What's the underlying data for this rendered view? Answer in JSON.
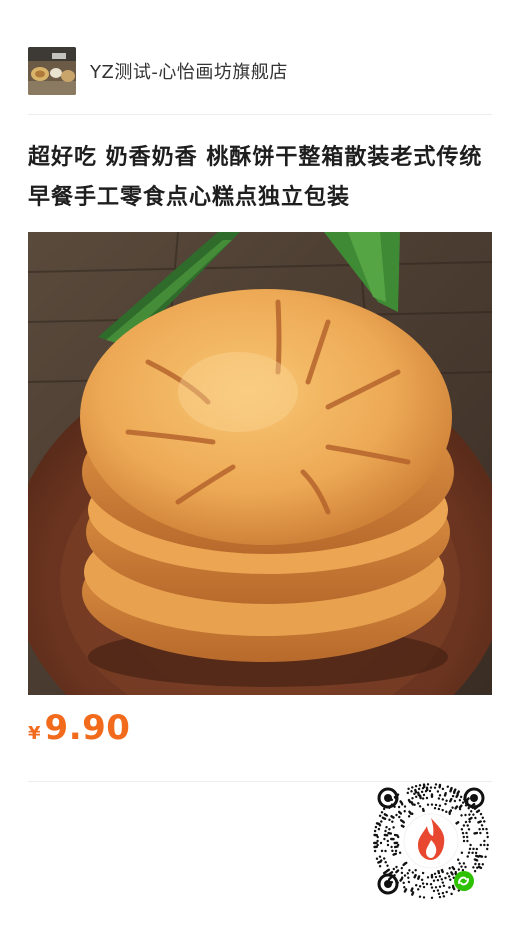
{
  "shop": {
    "name": "YZ测试-心怡画坊旗舰店"
  },
  "product": {
    "title": "超好吃 奶香奶香 桃酥饼干整箱散装老式传统早餐手工零食点心糕点独立包装",
    "price_currency": "¥",
    "price": "9.90"
  },
  "colors": {
    "price": "#f26b1d",
    "qr_flame": "#e8482f",
    "wechat_badge": "#2dc100"
  },
  "icons": {
    "qr": "mini-program-code",
    "badge": "wechat-mini-program-icon"
  }
}
